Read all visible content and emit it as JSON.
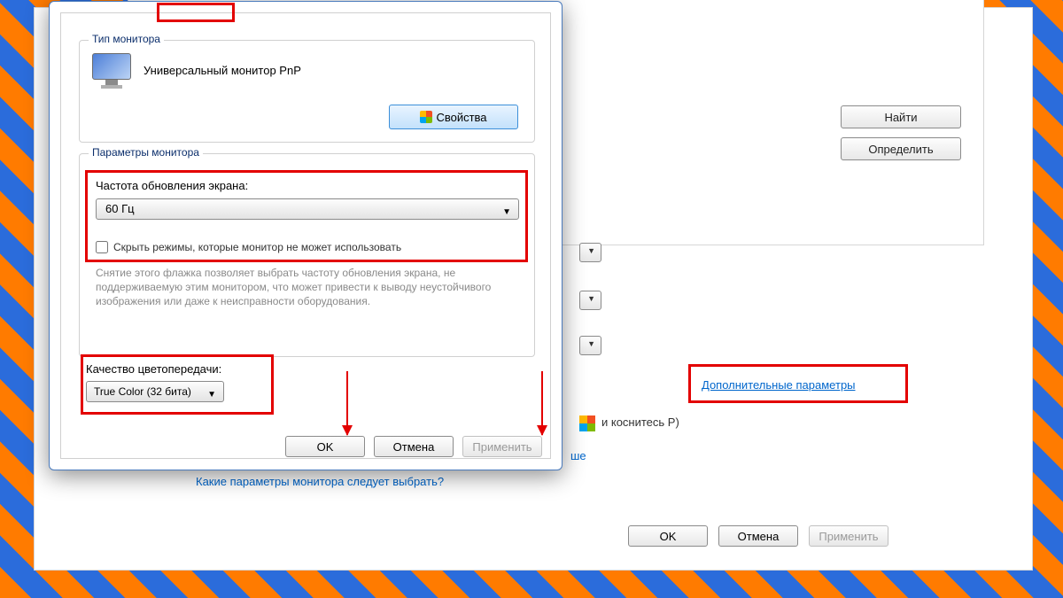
{
  "background": {
    "find_btn": "Найти",
    "detect_btn": "Определить",
    "touch_text": "и коснитесь P)",
    "adv_link": "Дополнительные параметры",
    "help_partial": "ше",
    "help_link": "Какие параметры монитора следует выбрать?",
    "ok": "OK",
    "cancel": "Отмена",
    "apply": "Применить"
  },
  "dialog": {
    "type_group": "Тип монитора",
    "monitor_name": "Универсальный монитор PnP",
    "properties_btn": "Свойства",
    "params_group": "Параметры монитора",
    "refresh_label": "Частота обновления экрана:",
    "refresh_value": "60 Гц",
    "hide_modes": "Скрыть режимы, которые монитор не может использовать",
    "warning": "Снятие этого флажка позволяет выбрать частоту обновления экрана, не поддерживаемую этим монитором, что может привести к выводу неустойчивого изображения или даже к неисправности оборудования.",
    "color_label": "Качество цветопередачи:",
    "color_value": "True Color (32 бита)",
    "ok": "OK",
    "cancel": "Отмена",
    "apply": "Применить"
  }
}
